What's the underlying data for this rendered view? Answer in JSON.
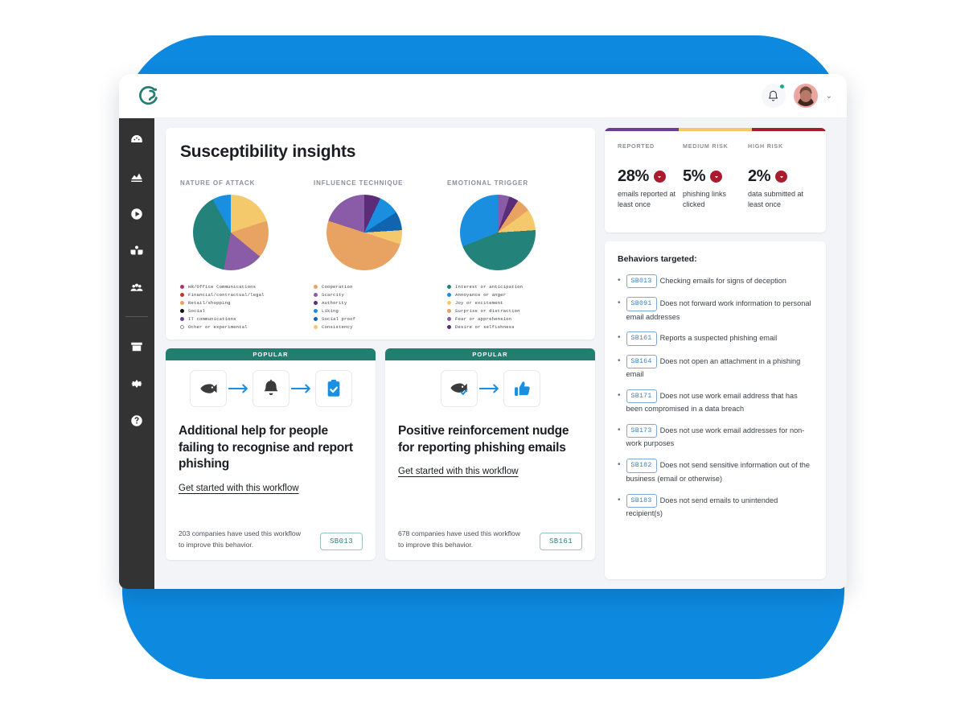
{
  "theme": {
    "backdrop_blue": "#0d8ae0",
    "sidebar_dark": "#333333",
    "brand_teal": "#227f70",
    "accent_blue": "#1a8fe0",
    "danger_red": "#a81d2d"
  },
  "header": {
    "logo_name": "brand-logo",
    "bell_label": "Notifications",
    "has_notification_dot": true,
    "avatar_label": "User avatar",
    "chevron": "⌄"
  },
  "sidebar": {
    "items": [
      {
        "icon": "dashboard-gauge-icon",
        "label": "Dashboard"
      },
      {
        "icon": "bar-chart-icon",
        "label": "Reports"
      },
      {
        "icon": "play-circle-icon",
        "label": "Training"
      },
      {
        "icon": "open-book-icon",
        "label": "Learning"
      },
      {
        "icon": "people-group-icon",
        "label": "People"
      },
      {
        "icon": "archive-box-icon",
        "label": "Archive"
      },
      {
        "icon": "gear-icon",
        "label": "Settings"
      },
      {
        "icon": "question-circle-icon",
        "label": "Help"
      }
    ],
    "divider_after_index": 4
  },
  "insights": {
    "title": "Susceptibility insights"
  },
  "chart_data": [
    {
      "type": "pie",
      "title": "NATURE OF ATTACK",
      "labels": [
        "HR/Office Communications",
        "Financial/contractual/legal",
        "Retail/shopping",
        "Social",
        "IT communications",
        "Other or experimental"
      ],
      "legend_colors": [
        "#a8376a",
        "#c0392b",
        "#e8a362",
        "#111111",
        "#6b3f8f",
        "#ffffff"
      ],
      "slice_order": [
        "Retail/shopping",
        "Financial/contractual/legal",
        "IT communications",
        "HR/Office Communications",
        "Social"
      ],
      "values": [
        20,
        16,
        17,
        39,
        8
      ],
      "slice_colors": [
        "#f4c96b",
        "#e8a362",
        "#8a5ba6",
        "#23827a",
        "#1a8fe0"
      ],
      "legend_position": "bottom"
    },
    {
      "type": "pie",
      "title": "INFLUENCE TECHNIQUE",
      "labels": [
        "Cooperation",
        "Scarcity",
        "Authority",
        "Liking",
        "Social proof",
        "Consistency"
      ],
      "legend_colors": [
        "#e8a362",
        "#8a5ba6",
        "#5b2d79",
        "#1a8fe0",
        "#1064b0",
        "#f4c96b"
      ],
      "values": [
        7,
        9,
        8,
        6,
        50,
        20
      ],
      "slice_colors": [
        "#5b2d79",
        "#1a8fe0",
        "#1064b0",
        "#f4c96b",
        "#e8a362",
        "#8a5ba6"
      ],
      "legend_position": "bottom"
    },
    {
      "type": "pie",
      "title": "EMOTIONAL TRIGGER",
      "labels": [
        "Interest or anticipation",
        "Annoyance or anger",
        "Joy or excitement",
        "Surprise or distraction",
        "Fear or apprehension",
        "Desire or selfishness"
      ],
      "legend_colors": [
        "#23827a",
        "#1a8fe0",
        "#f4c96b",
        "#e8a362",
        "#8a5ba6",
        "#5b2d79"
      ],
      "values": [
        5,
        4,
        6,
        9,
        45,
        31
      ],
      "slice_colors": [
        "#8a5ba6",
        "#5b2d79",
        "#e8a362",
        "#f4c96b",
        "#23827a",
        "#1a8fe0"
      ],
      "legend_position": "bottom"
    }
  ],
  "workflows": [
    {
      "ribbon": "POPULAR",
      "icons": [
        "fish-icon",
        "bell-icon",
        "clipboard-check-icon"
      ],
      "title": "Additional help for people failing to recognise and report phishing",
      "link": "Get started with this workflow",
      "footnote": "203 companies have used this workflow to improve this behavior.",
      "code": "SB013"
    },
    {
      "ribbon": "POPULAR",
      "icons": [
        "fish-check-icon",
        "thumbs-up-icon"
      ],
      "title": "Positive reinforcement nudge for reporting phishing emails",
      "link": "Get started with this workflow",
      "footnote": "678 companies have used this workflow to improve this behavior.",
      "code": "SB161"
    }
  ],
  "stats": {
    "top_bars": [
      "#6b3f8f",
      "#f4c96b",
      "#a81d2d"
    ],
    "items": [
      {
        "label": "REPORTED",
        "value": "28%",
        "desc": "emails reported at least once",
        "badge": "chevron-down-icon"
      },
      {
        "label": "MEDIUM RISK",
        "value": "5%",
        "desc": "phishing links clicked",
        "badge": "chevron-down-icon"
      },
      {
        "label": "HIGH RISK",
        "value": "2%",
        "desc": "data submitted at least once",
        "badge": "chevron-down-icon"
      }
    ]
  },
  "behaviors": {
    "heading": "Behaviors targeted:",
    "items": [
      {
        "code": "SB013",
        "text": "Checking emails for signs of deception"
      },
      {
        "code": "SB091",
        "text": "Does not forward work information to personal email addresses"
      },
      {
        "code": "SB161",
        "text": "Reports a suspected phishing email"
      },
      {
        "code": "SB164",
        "text": "Does not open an attachment in a phishing email"
      },
      {
        "code": "SB171",
        "text": "Does not use work email address that has been compromised in a data breach"
      },
      {
        "code": "SB173",
        "text": "Does not use work email addresses for non-work purposes"
      },
      {
        "code": "SB182",
        "text": "Does not send sensitive information out of the business (email or otherwise)"
      },
      {
        "code": "SB183",
        "text": "Does not send emails to unintended recipient(s)"
      }
    ]
  }
}
